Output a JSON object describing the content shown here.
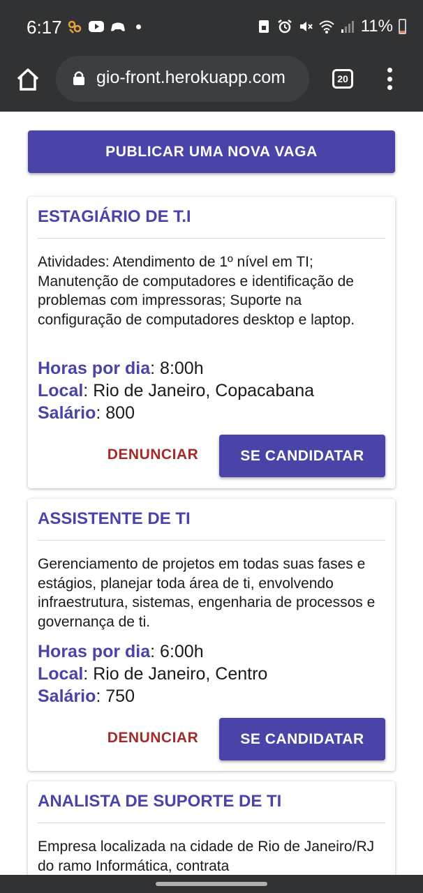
{
  "status_bar": {
    "time": "6:17",
    "battery": "11%",
    "left_icons": [
      "notification-app-icon",
      "youtube-icon",
      "game-controller-icon"
    ],
    "right_icons": [
      "save-icon",
      "alarm-icon",
      "mute-icon",
      "wifi-icon",
      "signal-icon",
      "battery-icon"
    ]
  },
  "browser": {
    "url": "gio-front.herokuapp.com",
    "tab_count": "20"
  },
  "publish_button": "PUBLICAR UMA NOVA VAGA",
  "jobs": [
    {
      "title": "ESTAGIÁRIO DE T.I",
      "description": "Atividades: Atendimento de 1º nível em TI; Manutenção de computadores e identificação de problemas com impressoras; Suporte na configuração de computadores desktop e laptop.",
      "hours_label": "Horas por dia",
      "hours": ": 8:00h",
      "location_label": "Local",
      "location": ": Rio de Janeiro, Copacabana",
      "salary_label": "Salário",
      "salary": ": 800",
      "report_label": "DENUNCIAR",
      "apply_label": "SE CANDIDATAR"
    },
    {
      "title": "ASSISTENTE DE TI",
      "description": "Gerenciamento de projetos em todas suas fases e estágios, planejar toda área de ti, envolvendo infraestrutura, sistemas, engenharia de processos e governança de ti.",
      "hours_label": "Horas por dia",
      "hours": ": 6:00h",
      "location_label": "Local",
      "location": ": Rio de Janeiro, Centro",
      "salary_label": "Salário",
      "salary": ": 750",
      "report_label": "DENUNCIAR",
      "apply_label": "SE CANDIDATAR"
    },
    {
      "title": "ANALISTA DE SUPORTE DE TI",
      "description": "Empresa localizada na cidade de Rio de Janeiro/RJ do ramo Informática, contrata"
    }
  ],
  "colors": {
    "primary": "#4a44a9",
    "danger": "#a52a2a",
    "chrome": "#303233"
  }
}
